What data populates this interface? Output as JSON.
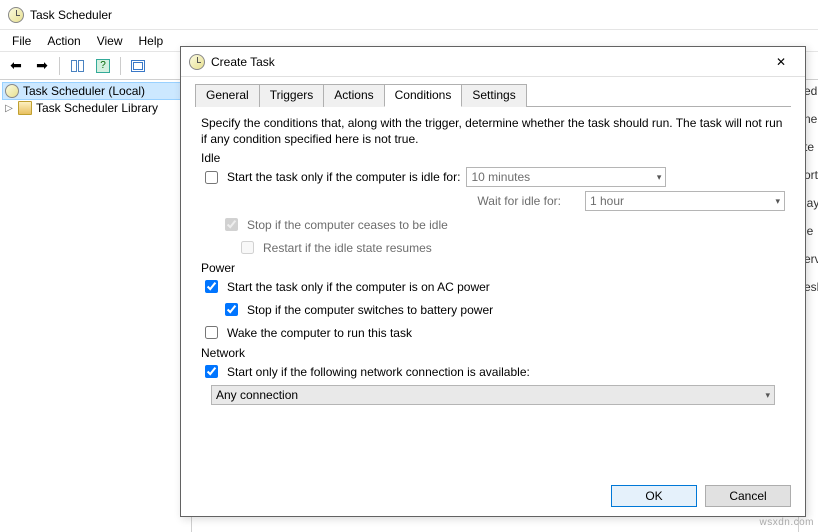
{
  "app": {
    "title": "Task Scheduler"
  },
  "menu": {
    "file": "File",
    "action": "Action",
    "view": "View",
    "help": "Help"
  },
  "tree": {
    "root": "Task Scheduler (Local)",
    "library": "Task Scheduler Library"
  },
  "right_clip": {
    "l0": "edu",
    "l1": "ne",
    "l2": "te",
    "l3": "ort",
    "l4": "lay",
    "l5": "le",
    "l6": "erv",
    "l7": "esh"
  },
  "dialog": {
    "title": "Create Task",
    "tabs": {
      "general": "General",
      "triggers": "Triggers",
      "actions": "Actions",
      "conditions": "Conditions",
      "settings": "Settings"
    },
    "desc": "Specify the conditions that, along with the trigger, determine whether the task should run.  The task will not run  if any condition specified here is not true.",
    "idle": {
      "section": "Idle",
      "start_label": "Start the task only if the computer is idle for:",
      "duration": "10 minutes",
      "wait_label": "Wait for idle for:",
      "wait_value": "1 hour",
      "stop_label": "Stop if the computer ceases to be idle",
      "restart_label": "Restart if the idle state resumes"
    },
    "power": {
      "section": "Power",
      "ac_label": "Start the task only if the computer is on AC power",
      "battery_label": "Stop if the computer switches to battery power",
      "wake_label": "Wake the computer to run this task"
    },
    "network": {
      "section": "Network",
      "start_label": "Start only if the following network connection is available:",
      "value": "Any connection"
    },
    "buttons": {
      "ok": "OK",
      "cancel": "Cancel"
    }
  },
  "watermark": "wsxdn.com"
}
